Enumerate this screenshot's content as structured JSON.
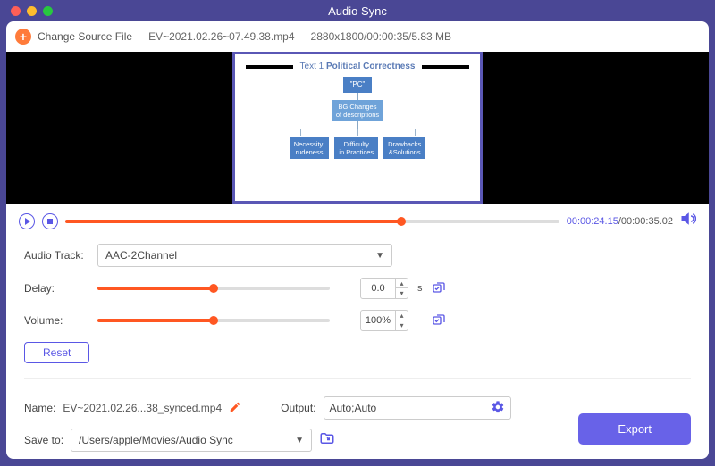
{
  "app": {
    "title": "Audio Sync"
  },
  "header": {
    "change_source_label": "Change Source File",
    "filename": "EV~2021.02.26~07.49.38.mp4",
    "fileinfo": "2880x1800/00:00:35/5.83 MB"
  },
  "thumb": {
    "heading_pre": "Text 1",
    "heading_bold": "Political Correctness",
    "box_pc": "\"PC\"",
    "box_bg": "BG:Changes\nof descriptions",
    "box_necessity": "Necessity:\nrudeness",
    "box_difficulty": "Difficulty\nin Practices",
    "box_drawbacks": "Drawbacks\n&Solutions"
  },
  "player": {
    "time_current": "00:00:24.15",
    "time_total": "/00:00:35.02",
    "progress_pct": 68
  },
  "controls": {
    "audio_track_label": "Audio Track:",
    "audio_track_value": "AAC-2Channel",
    "delay_label": "Delay:",
    "delay_value": "0.0",
    "delay_unit": "s",
    "delay_slider_pct": 50,
    "volume_label": "Volume:",
    "volume_value": "100%",
    "volume_slider_pct": 50,
    "reset_label": "Reset"
  },
  "footer": {
    "name_label": "Name:",
    "name_value": "EV~2021.02.26...38_synced.mp4",
    "output_label": "Output:",
    "output_value": "Auto;Auto",
    "saveto_label": "Save to:",
    "saveto_value": "/Users/apple/Movies/Audio Sync",
    "export_label": "Export"
  }
}
